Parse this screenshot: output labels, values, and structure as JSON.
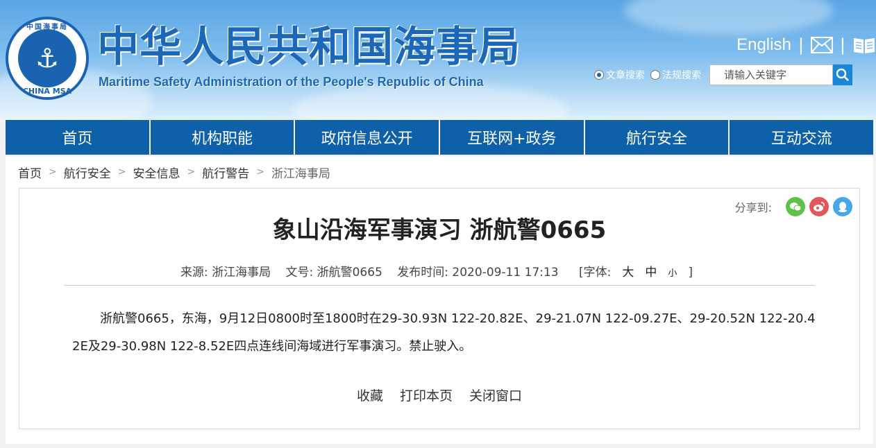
{
  "header": {
    "logo": {
      "top_text": "中国海事局",
      "bottom_text": "CHINA MSA"
    },
    "title_cn": "中华人民共和国海事局",
    "title_en": "Maritime Safety Administration of the People's Republic of China",
    "english_link": "English",
    "separator": "|",
    "icons": {
      "mail": "mail-icon",
      "book": "book-icon"
    },
    "search": {
      "radio_article": "文章搜索",
      "radio_law": "法规搜索",
      "placeholder": "请输入关键字"
    }
  },
  "nav": {
    "items": [
      "首页",
      "机构职能",
      "政府信息公开",
      "互联网+政务",
      "航行安全",
      "互动交流"
    ]
  },
  "breadcrumb": {
    "items": [
      "首页",
      "航行安全",
      "安全信息",
      "航行警告"
    ],
    "current": "浙江海事局",
    "separator": ">"
  },
  "article": {
    "share_label": "分享到:",
    "title": "象山沿海军事演习 浙航警0665",
    "meta": {
      "source": "来源: 浙江海事局",
      "doc_no": "文号: 浙航警0665",
      "published": "发布时间: 2020-09-11 17:13",
      "font_label": "[字体:",
      "font_large": "大",
      "font_medium": "中",
      "font_small": "小",
      "font_close": "]"
    },
    "body": "浙航警0665，东海，9月12日0800时至1800时在29-30.93N 122-20.82E、29-21.07N 122-09.27E、29-20.52N 122-20.42E及29-30.98N 122-8.52E四点连线间海域进行军事演习。禁止驶入。",
    "actions": {
      "favorite": "收藏",
      "print": "打印本页",
      "close": "关闭窗口"
    }
  },
  "colors": {
    "brand_blue": "#1b67b8",
    "nav_blue": "#0e60a8",
    "search_blue": "#1a86d8"
  }
}
